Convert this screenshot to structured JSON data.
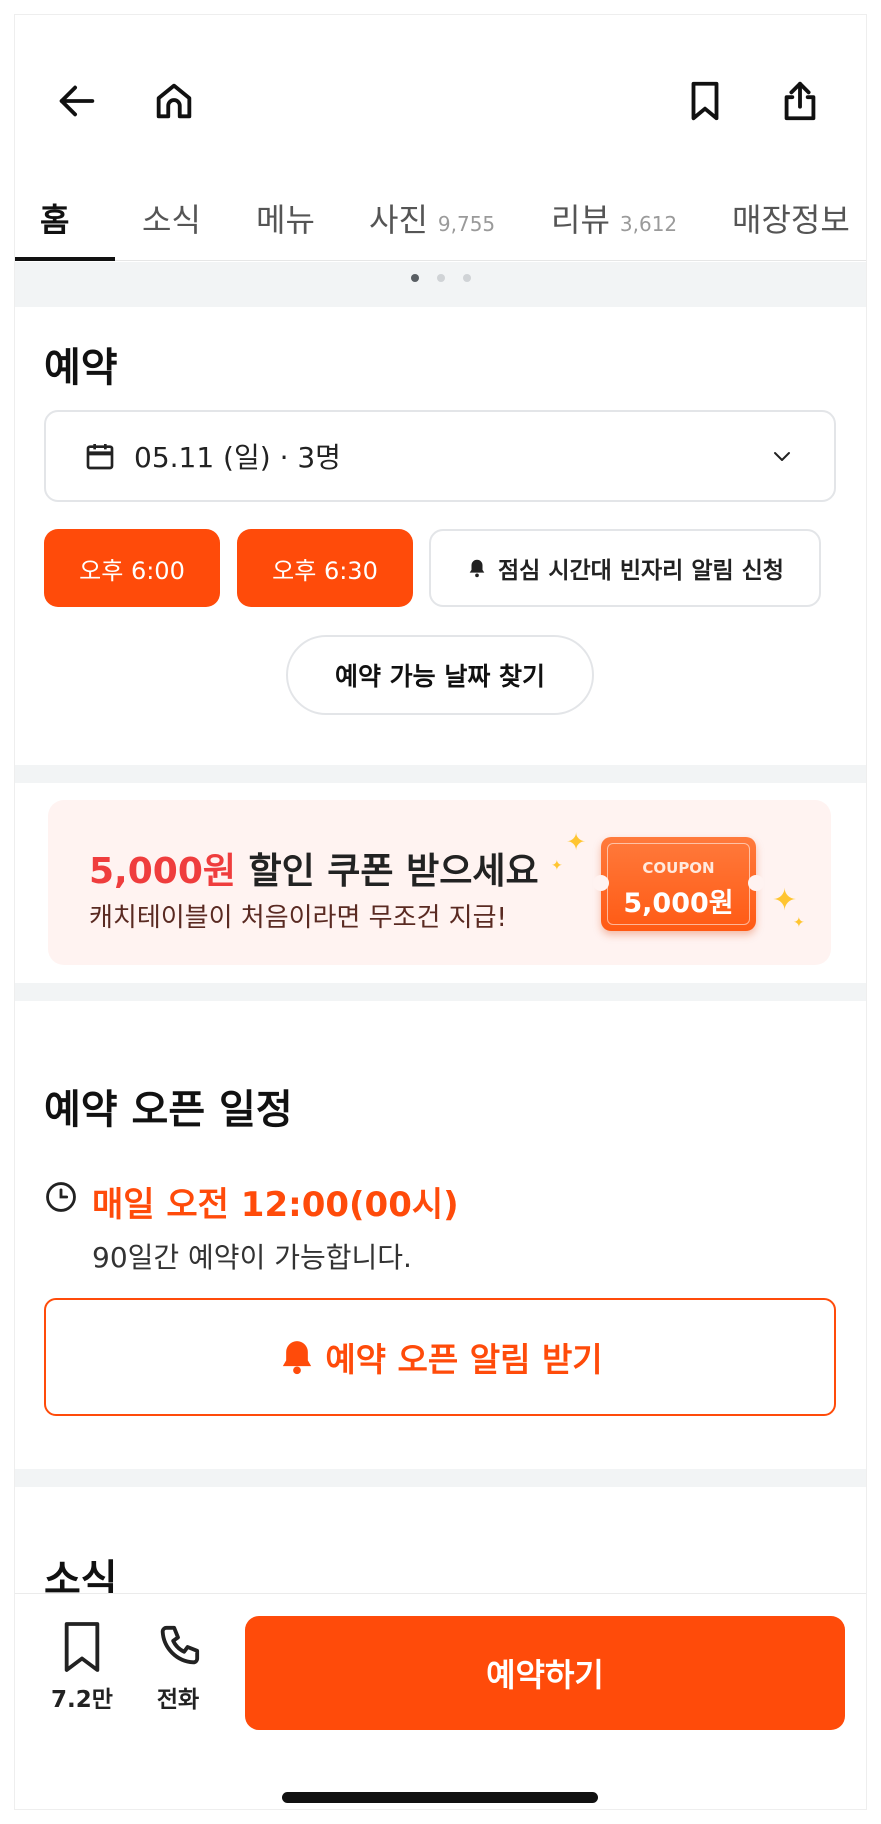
{
  "topbar": {
    "back_icon": "arrow-left-icon",
    "home_icon": "home-icon",
    "bookmark_icon": "bookmark-icon",
    "share_icon": "share-icon"
  },
  "tabs": [
    {
      "label": "홈",
      "count": ""
    },
    {
      "label": "소식",
      "count": ""
    },
    {
      "label": "메뉴",
      "count": ""
    },
    {
      "label": "사진",
      "count": "9,755"
    },
    {
      "label": "리뷰",
      "count": "3,612"
    },
    {
      "label": "매장정보",
      "count": ""
    }
  ],
  "reservation": {
    "title": "예약",
    "date_value": "05.11 (일) · 3명",
    "times": [
      "오후 6:00",
      "오후 6:30"
    ],
    "alert_label": "점심 시간대 빈자리 알림 신청",
    "find_date_label": "예약 가능 날짜 찾기"
  },
  "coupon_banner": {
    "amount": "5,000원",
    "headline_rest": " 할인 쿠폰 받으세요",
    "subtext": "캐치테이블이 처음이라면 무조건 지급!",
    "coupon_label": "COUPON",
    "coupon_value": "5,000원"
  },
  "open_schedule": {
    "title": "예약 오픈 일정",
    "time": "매일 오전 12:00(00시)",
    "desc": "90일간 예약이 가능합니다.",
    "notify_label": "예약 오픈 알림 받기"
  },
  "news": {
    "title": "소식"
  },
  "bottombar": {
    "save_count": "7.2만",
    "call_label": "전화",
    "reserve_label": "예약하기"
  },
  "colors": {
    "accent": "#ff4b0a",
    "coupon_red": "#ef3d3d",
    "banner_bg": "#fff3f1"
  }
}
